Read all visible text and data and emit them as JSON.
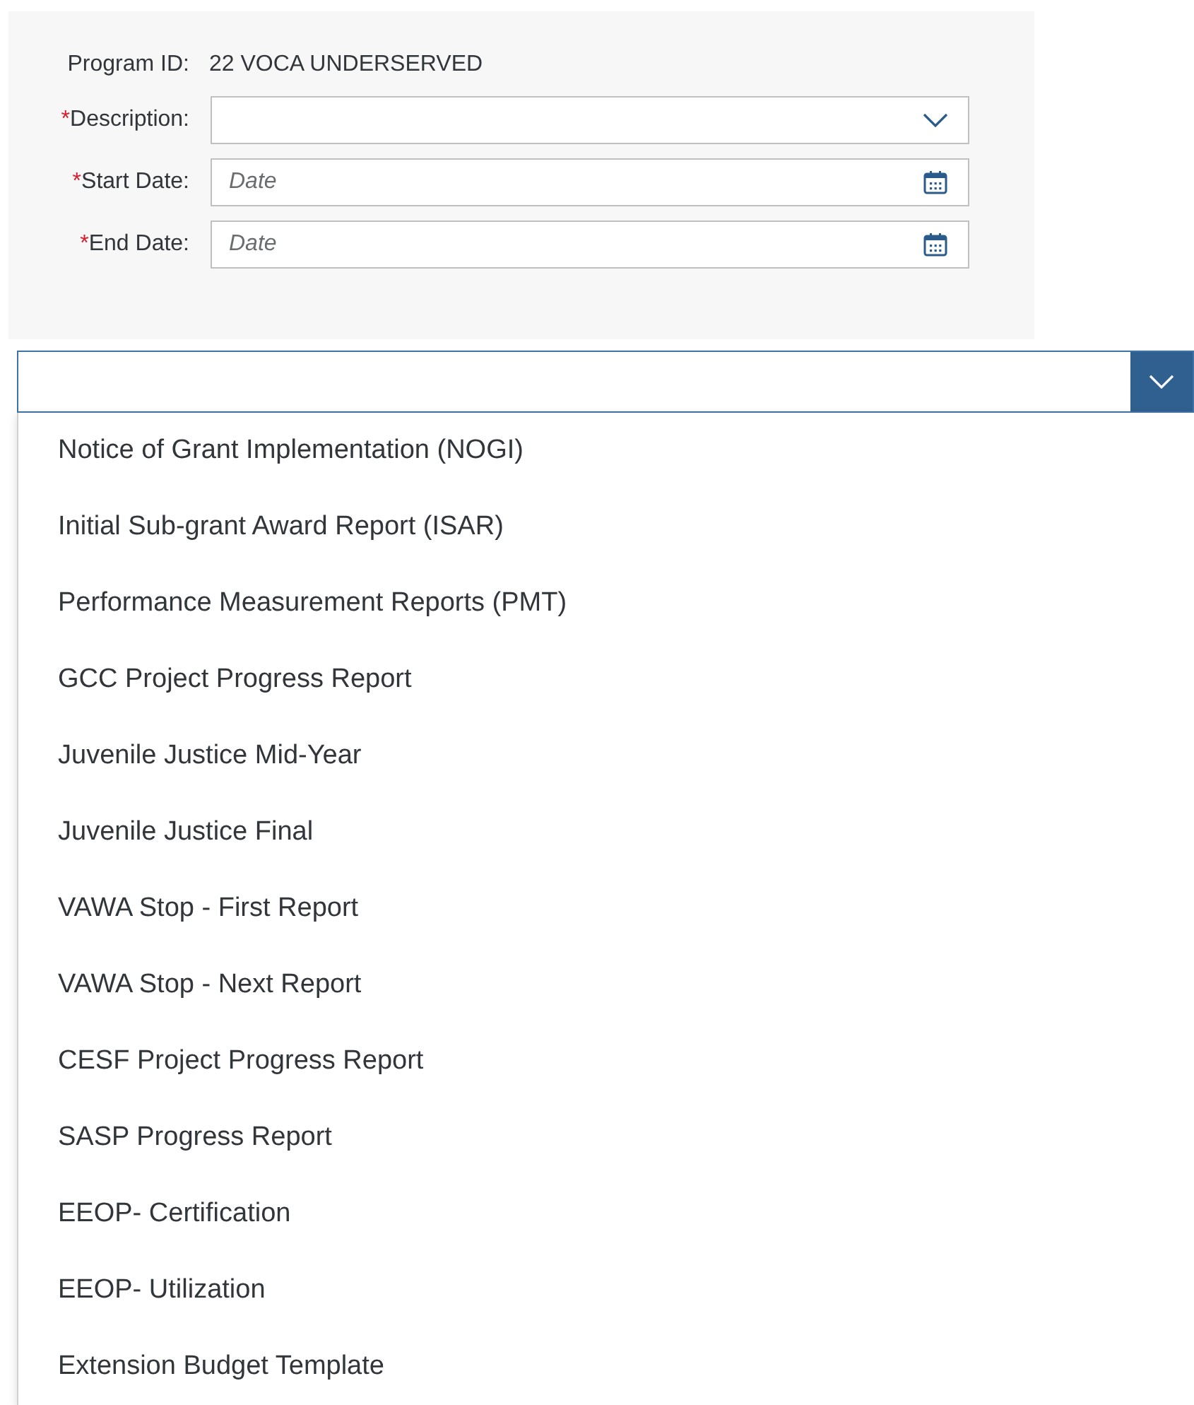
{
  "form": {
    "program_id": {
      "label": "Program ID:",
      "value": "22 VOCA UNDERSERVED"
    },
    "fields": [
      {
        "kind": "select",
        "required_mark": "*",
        "label": "Description:"
      },
      {
        "kind": "date",
        "required_mark": "*",
        "label": "Start Date:",
        "placeholder": "Date"
      },
      {
        "kind": "date",
        "required_mark": "*",
        "label": "End Date:",
        "placeholder": "Date"
      }
    ]
  },
  "report_select": {
    "expanded": true,
    "options": [
      "Notice of Grant Implementation (NOGI)",
      "Initial Sub-grant Award Report (ISAR)",
      "Performance Measurement Reports (PMT)",
      "GCC Project Progress Report",
      "Juvenile Justice Mid-Year",
      "Juvenile Justice Final",
      "VAWA Stop - First Report",
      "VAWA Stop - Next Report",
      "CESF Project Progress Report",
      "SASP Progress Report",
      "EEOP- Certification",
      "EEOP- Utilization",
      "Extension Budget Template"
    ]
  }
}
